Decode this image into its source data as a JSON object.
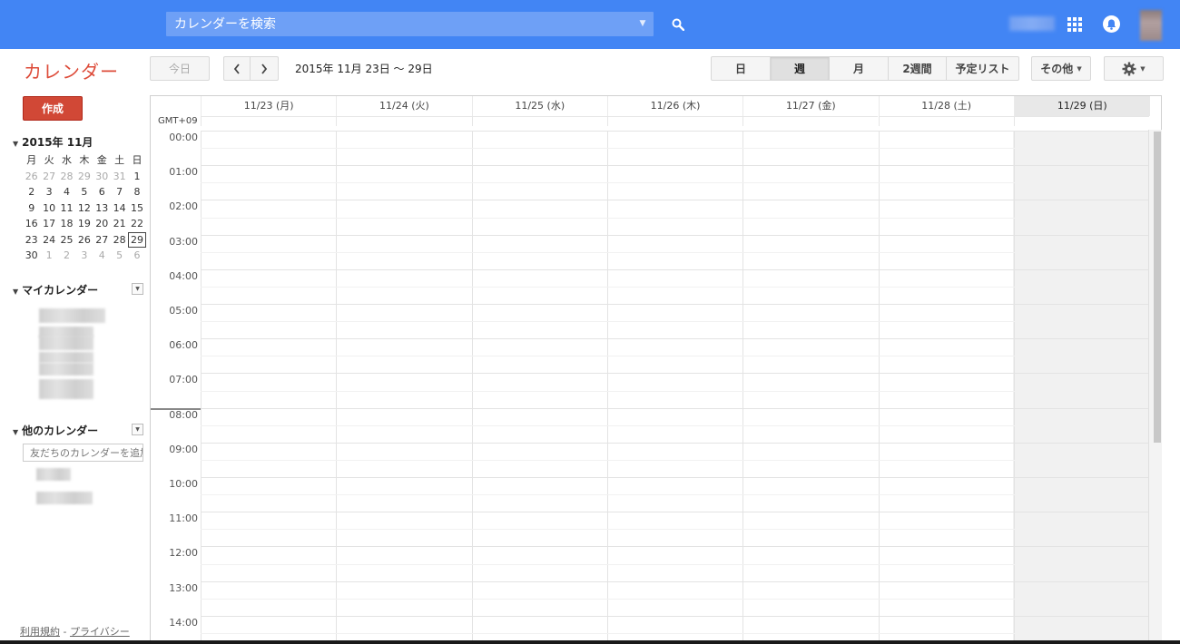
{
  "search": {
    "placeholder": "カレンダーを検索"
  },
  "app": {
    "title": "カレンダー"
  },
  "toolbar": {
    "today": "今日",
    "date_range": "2015年 11月 23日 〜 29日",
    "views": [
      {
        "label": "日",
        "active": false
      },
      {
        "label": "週",
        "active": true
      },
      {
        "label": "月",
        "active": false
      },
      {
        "label": "2週間",
        "active": false
      },
      {
        "label": "予定リスト",
        "active": false
      }
    ],
    "more": "その他"
  },
  "sidebar": {
    "create": "作成",
    "mini_calendar": {
      "title": "2015年 11月",
      "weekdays": [
        "月",
        "火",
        "水",
        "木",
        "金",
        "土",
        "日"
      ],
      "weeks": [
        [
          {
            "d": "26",
            "o": true
          },
          {
            "d": "27",
            "o": true
          },
          {
            "d": "28",
            "o": true
          },
          {
            "d": "29",
            "o": true
          },
          {
            "d": "30",
            "o": true
          },
          {
            "d": "31",
            "o": true
          },
          {
            "d": "1",
            "o": false
          }
        ],
        [
          {
            "d": "2",
            "o": false
          },
          {
            "d": "3",
            "o": false
          },
          {
            "d": "4",
            "o": false
          },
          {
            "d": "5",
            "o": false
          },
          {
            "d": "6",
            "o": false
          },
          {
            "d": "7",
            "o": false
          },
          {
            "d": "8",
            "o": false
          }
        ],
        [
          {
            "d": "9",
            "o": false
          },
          {
            "d": "10",
            "o": false
          },
          {
            "d": "11",
            "o": false
          },
          {
            "d": "12",
            "o": false
          },
          {
            "d": "13",
            "o": false
          },
          {
            "d": "14",
            "o": false
          },
          {
            "d": "15",
            "o": false
          }
        ],
        [
          {
            "d": "16",
            "o": false
          },
          {
            "d": "17",
            "o": false
          },
          {
            "d": "18",
            "o": false
          },
          {
            "d": "19",
            "o": false
          },
          {
            "d": "20",
            "o": false
          },
          {
            "d": "21",
            "o": false
          },
          {
            "d": "22",
            "o": false
          }
        ],
        [
          {
            "d": "23",
            "o": false
          },
          {
            "d": "24",
            "o": false
          },
          {
            "d": "25",
            "o": false
          },
          {
            "d": "26",
            "o": false
          },
          {
            "d": "27",
            "o": false
          },
          {
            "d": "28",
            "o": false
          },
          {
            "d": "29",
            "o": false,
            "selected": true
          }
        ],
        [
          {
            "d": "30",
            "o": false
          },
          {
            "d": "1",
            "o": true
          },
          {
            "d": "2",
            "o": true
          },
          {
            "d": "3",
            "o": true
          },
          {
            "d": "4",
            "o": true
          },
          {
            "d": "5",
            "o": true
          },
          {
            "d": "6",
            "o": true
          }
        ]
      ]
    },
    "my_calendars": "マイカレンダー",
    "other_calendars": "他のカレンダー",
    "add_friend_placeholder": "友だちのカレンダーを追加",
    "footer_terms": "利用規約",
    "footer_sep": " - ",
    "footer_privacy": "プライバシー"
  },
  "grid": {
    "timezone": "GMT+09",
    "days": [
      "11/23 (月)",
      "11/24 (火)",
      "11/25 (水)",
      "11/26 (木)",
      "11/27 (金)",
      "11/28 (土)",
      "11/29 (日)"
    ],
    "hours": [
      "00:00",
      "01:00",
      "02:00",
      "03:00",
      "04:00",
      "05:00",
      "06:00",
      "07:00",
      "08:00",
      "09:00",
      "10:00",
      "11:00",
      "12:00",
      "13:00",
      "14:00"
    ]
  },
  "icons": {
    "search": "search-icon",
    "apps": "apps-grid-icon",
    "notifications": "bell-icon",
    "settings": "gear-icon"
  },
  "colors": {
    "topbar": "#4285f4",
    "brand_red": "#dd4b39",
    "create_button": "#d14836"
  }
}
